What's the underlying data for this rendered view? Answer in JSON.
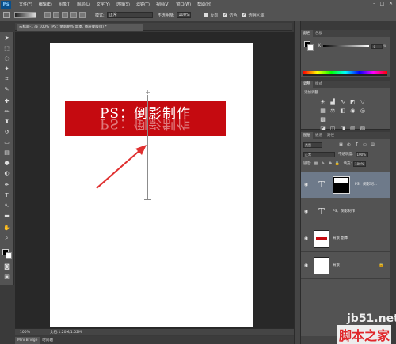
{
  "app": {
    "logo": "Ps"
  },
  "menu": [
    "文件(F)",
    "编辑(E)",
    "图像(I)",
    "图层(L)",
    "文字(Y)",
    "选择(S)",
    "滤镜(T)",
    "视图(V)",
    "窗口(W)",
    "帮助(H)"
  ],
  "window_controls": {
    "minimize": "–",
    "maximize": "□",
    "close": "✕"
  },
  "options": {
    "mode_label": "模式:",
    "mode_value": "正常",
    "opacity_label": "不透明度:",
    "opacity_value": "100%",
    "reverse_label": "反向",
    "dither_label": "仿色",
    "transparency_label": "透明区域"
  },
  "document": {
    "tab_label": "未标题-1 @ 100% (PS：倒影制作 副本, 图层蒙版/8) *",
    "banner_text": "PS：倒影制作",
    "banner_color": "#c50a10"
  },
  "status": {
    "zoom": "100%",
    "doc_info": "文档:1.20M/1.02M"
  },
  "bottom_tabs": [
    "Mini Bridge",
    "时间轴"
  ],
  "color_panel": {
    "tabs": [
      "颜色",
      "色板"
    ],
    "row_label": "K",
    "row_value": "0",
    "unit": "%"
  },
  "adjustments_panel": {
    "tabs": [
      "调整",
      "样式"
    ],
    "title": "添加调整"
  },
  "layers_panel": {
    "tabs": [
      "图层",
      "通道",
      "路径"
    ],
    "kind": "类型",
    "blend_mode": "正常",
    "opacity_label": "不透明度:",
    "opacity_value": "100%",
    "lock_label": "锁定:",
    "fill_label": "填充:",
    "fill_value": "100%",
    "layers": [
      {
        "name": "PS：倒影制…",
        "type": "text-with-mask",
        "selected": true
      },
      {
        "name": "PS：倒影制作",
        "type": "text",
        "selected": false
      },
      {
        "name": "背景 副本",
        "type": "image",
        "selected": false
      },
      {
        "name": "背景",
        "type": "background",
        "selected": false
      }
    ]
  },
  "watermark": {
    "site": "jb51.net",
    "brand": "脚本之家"
  }
}
